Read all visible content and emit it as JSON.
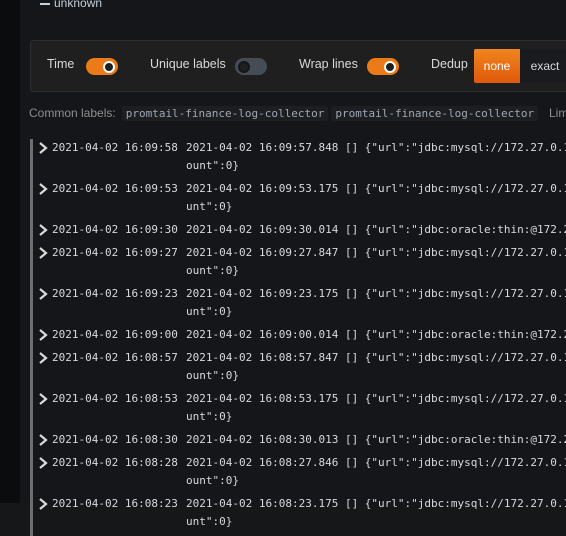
{
  "level_filter": {
    "label": "unknown"
  },
  "options": {
    "time": {
      "label": "Time",
      "on": true
    },
    "unique_labels": {
      "label": "Unique labels",
      "on": false
    },
    "wrap_lines": {
      "label": "Wrap lines",
      "on": true
    },
    "dedup": {
      "label": "Dedup",
      "options": [
        "none",
        "exact"
      ],
      "selected": "none"
    }
  },
  "common_labels": {
    "title": "Common labels:",
    "tags": [
      "promtail-finance-log-collector",
      "promtail-finance-log-collector"
    ],
    "limit_label": "Lim"
  },
  "logs": [
    {
      "timestamp": "2021-04-02 16:09:58",
      "line1": "2021-04-02 16:09:57.848 [] {\"url\":\"jdbc:mysql://172.27.0.1",
      "line2": "ount\":0}"
    },
    {
      "timestamp": "2021-04-02 16:09:53",
      "line1": "2021-04-02 16:09:53.175 [] {\"url\":\"jdbc:mysql://172.27.0.1",
      "line2": "unt\":0}"
    },
    {
      "timestamp": "2021-04-02 16:09:30",
      "line1": "2021-04-02 16:09:30.014 [] {\"url\":\"jdbc:oracle:thin:@172.2",
      "line2": ""
    },
    {
      "timestamp": "2021-04-02 16:09:27",
      "line1": "2021-04-02 16:09:27.847 [] {\"url\":\"jdbc:mysql://172.27.0.1",
      "line2": "ount\":0}"
    },
    {
      "timestamp": "2021-04-02 16:09:23",
      "line1": "2021-04-02 16:09:23.175 [] {\"url\":\"jdbc:mysql://172.27.0.1",
      "line2": "unt\":0}"
    },
    {
      "timestamp": "2021-04-02 16:09:00",
      "line1": "2021-04-02 16:09:00.014 [] {\"url\":\"jdbc:oracle:thin:@172.2",
      "line2": ""
    },
    {
      "timestamp": "2021-04-02 16:08:57",
      "line1": "2021-04-02 16:08:57.847 [] {\"url\":\"jdbc:mysql://172.27.0.1",
      "line2": "ount\":0}"
    },
    {
      "timestamp": "2021-04-02 16:08:53",
      "line1": "2021-04-02 16:08:53.175 [] {\"url\":\"jdbc:mysql://172.27.0.1",
      "line2": "unt\":0}"
    },
    {
      "timestamp": "2021-04-02 16:08:30",
      "line1": "2021-04-02 16:08:30.013 [] {\"url\":\"jdbc:oracle:thin:@172.2",
      "line2": ""
    },
    {
      "timestamp": "2021-04-02 16:08:28",
      "line1": "2021-04-02 16:08:27.846 [] {\"url\":\"jdbc:mysql://172.27.0.1",
      "line2": "ount\":0}"
    },
    {
      "timestamp": "2021-04-02 16:08:23",
      "line1": "2021-04-02 16:08:23.175 [] {\"url\":\"jdbc:mysql://172.27.0.1",
      "line2": "unt\":0}"
    }
  ],
  "colors": {
    "accent": "#eb7b18",
    "background": "#141619",
    "log_level_unknown": "#6e6e6e"
  },
  "icons": {
    "expand": "chevron-right-icon",
    "level_marker": "dash-icon"
  }
}
